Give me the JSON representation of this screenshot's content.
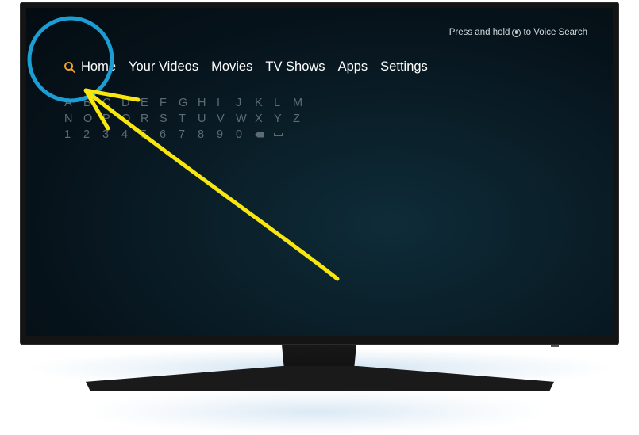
{
  "voice_search": {
    "prefix": "Press and hold",
    "suffix": "to Voice Search"
  },
  "nav": {
    "items": [
      {
        "label": "Home"
      },
      {
        "label": "Your Videos"
      },
      {
        "label": "Movies"
      },
      {
        "label": "TV Shows"
      },
      {
        "label": "Apps"
      },
      {
        "label": "Settings"
      }
    ]
  },
  "keyboard": {
    "row1": [
      "A",
      "B",
      "C",
      "D",
      "E",
      "F",
      "G",
      "H",
      "I",
      "J",
      "K",
      "L",
      "M"
    ],
    "row2": [
      "N",
      "O",
      "P",
      "Q",
      "R",
      "S",
      "T",
      "U",
      "V",
      "W",
      "X",
      "Y",
      "Z"
    ],
    "row3": [
      "1",
      "2",
      "3",
      "4",
      "5",
      "6",
      "7",
      "8",
      "9",
      "0"
    ]
  },
  "colors": {
    "search_icon": "#f0a12b",
    "annotation_circle": "#1a9ed4",
    "annotation_arrow": "#f7e70f",
    "keyboard_text": "#5d6c74"
  },
  "icons": {
    "search": "search-icon",
    "mic": "microphone-icon",
    "backspace": "backspace-icon",
    "space": "space-icon"
  }
}
